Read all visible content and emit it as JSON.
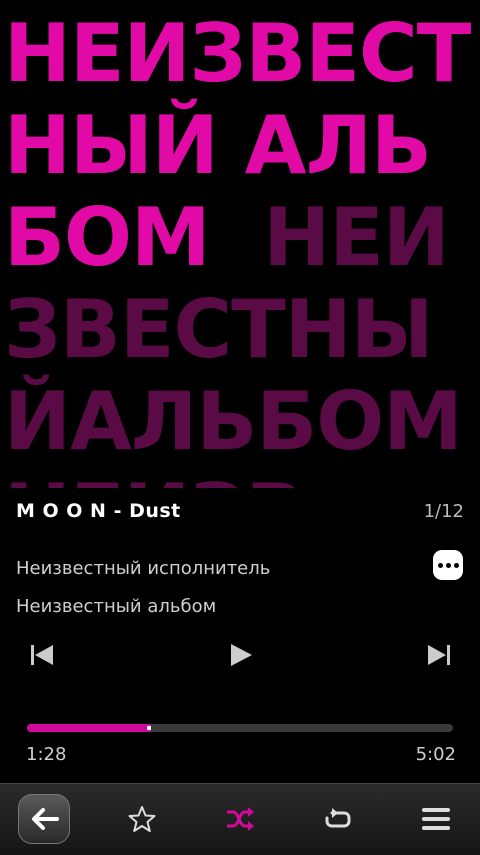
{
  "album_art": {
    "primary_text": "НЕИЗВЕСТНЫЙ АЛЬБОМ",
    "secondary_text": "НЕИЗВЕСТНЫЙАЛЬБОМНЕИЗВ",
    "primary_color": "#e10aa6",
    "secondary_color": "#5a0a45"
  },
  "track": {
    "title": "M O O N - Dust",
    "position": "1/12",
    "artist": "Неизвестный исполнитель",
    "album": "Неизвестный альбом"
  },
  "player": {
    "elapsed": "1:28",
    "duration": "5:02",
    "progress_fraction": 0.29,
    "accent_color": "#d10a9c"
  },
  "icons": {
    "more": "more-icon",
    "previous": "previous-icon",
    "play": "play-icon",
    "next": "next-icon",
    "back": "back-arrow-icon",
    "favorite": "star-icon",
    "shuffle": "shuffle-icon",
    "repeat": "repeat-icon",
    "menu": "menu-icon"
  }
}
